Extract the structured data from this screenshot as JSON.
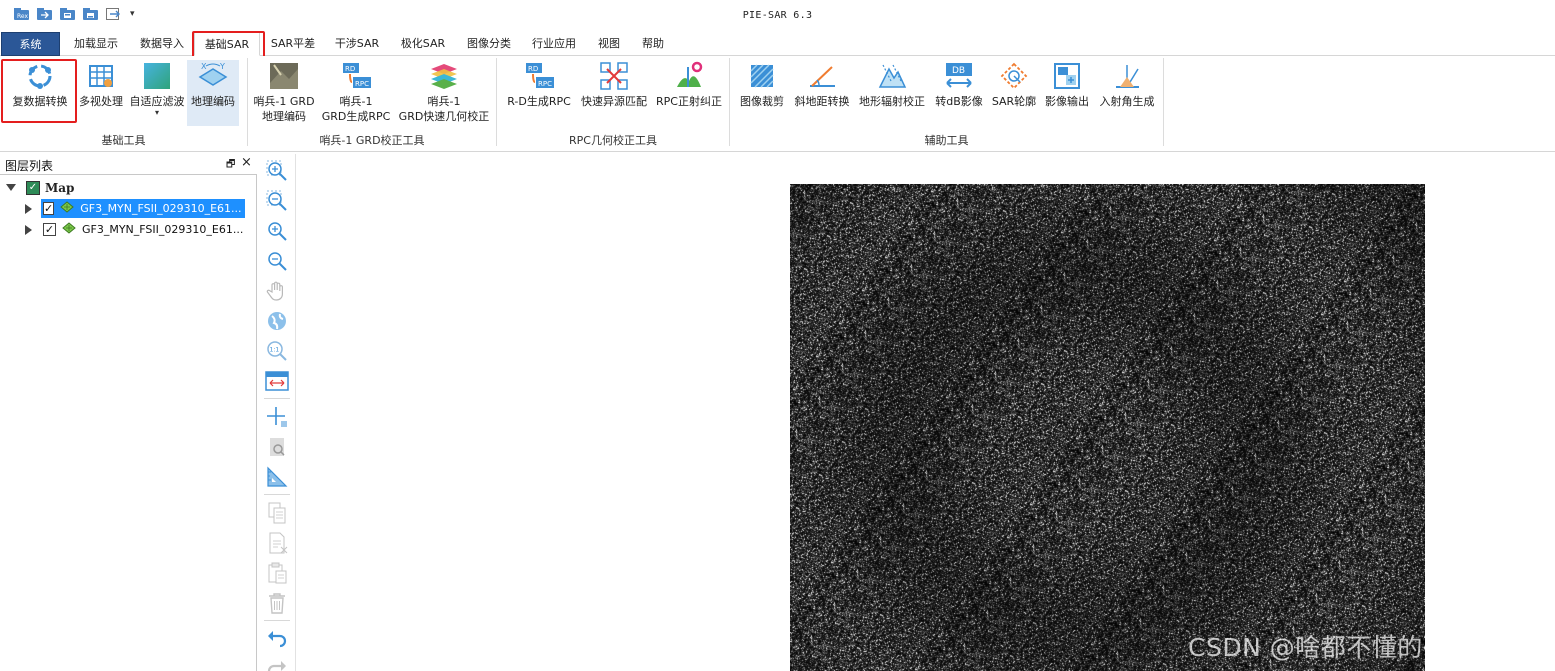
{
  "window": {
    "title": "PIE-SAR 6.3",
    "quick_access": [
      {
        "icon": "new-file-icon"
      },
      {
        "icon": "open-folder-icon"
      },
      {
        "icon": "save-icon"
      },
      {
        "icon": "save-as-icon"
      },
      {
        "icon": "export-icon"
      }
    ],
    "quick_access_dropdown": "▾"
  },
  "menu": {
    "system": "系统",
    "tabs": [
      "加载显示",
      "数据导入",
      "基础SAR",
      "SAR平差",
      "干涉SAR",
      "极化SAR",
      "图像分类",
      "行业应用",
      "视图",
      "帮助"
    ],
    "active_tab": "基础SAR"
  },
  "ribbon": {
    "groups": [
      {
        "label": "基础工具",
        "buttons": [
          {
            "label": "复数据转换",
            "icon": "complex-data-convert-icon",
            "highlighted": true
          },
          {
            "label": "多视处理",
            "icon": "multilook-icon"
          },
          {
            "label": "自适应滤波",
            "icon": "adaptive-filter-icon",
            "dropdown": "▾"
          },
          {
            "label": "地理编码",
            "icon": "geocode-icon"
          }
        ]
      },
      {
        "label": "哨兵-1 GRD校正工具",
        "buttons": [
          {
            "label": "哨兵-1 GRD",
            "label2": "地理编码",
            "icon": "sentinel-geocode-icon"
          },
          {
            "label": "哨兵-1",
            "label2": "GRD生成RPC",
            "icon": "rd-rpc-icon"
          },
          {
            "label": "哨兵-1",
            "label2": "GRD快速几何校正",
            "icon": "fast-geometry-icon"
          }
        ]
      },
      {
        "label": "RPC几何校正工具",
        "buttons": [
          {
            "label": "R-D生成RPC",
            "icon": "rd-rpc-icon"
          },
          {
            "label": "快速异源匹配",
            "icon": "heterologous-match-icon"
          },
          {
            "label": "RPC正射纠正",
            "icon": "ortho-correct-icon"
          }
        ]
      },
      {
        "label": "辅助工具",
        "buttons": [
          {
            "label": "图像裁剪",
            "icon": "image-crop-icon"
          },
          {
            "label": "斜地距转换",
            "icon": "slant-ground-icon"
          },
          {
            "label": "地形辐射校正",
            "icon": "terrain-radiometric-icon"
          },
          {
            "label": "转dB影像",
            "icon": "db-image-icon",
            "badge": "DB"
          },
          {
            "label": "SAR轮廓",
            "icon": "sar-outline-icon"
          },
          {
            "label": "影像输出",
            "icon": "image-export-icon"
          },
          {
            "label": "入射角生成",
            "icon": "incidence-angle-icon"
          }
        ]
      }
    ]
  },
  "layer_panel": {
    "title": "图层列表",
    "pin_glyph": "🗗",
    "close_glyph": "×",
    "root": {
      "label": "Map",
      "checked": true
    },
    "layers": [
      {
        "label": "GF3_MYN_FSII_029310_E61...",
        "checked": true,
        "selected": true
      },
      {
        "label": "GF3_MYN_FSII_029310_E61...",
        "checked": true,
        "selected": false
      }
    ],
    "check_glyph": "✓"
  },
  "map_tools": [
    {
      "icon": "zoom-box-in-icon"
    },
    {
      "icon": "zoom-box-out-icon"
    },
    {
      "icon": "zoom-in-icon"
    },
    {
      "icon": "zoom-out-icon"
    },
    {
      "icon": "pan-hand-icon"
    },
    {
      "icon": "full-extent-globe-icon"
    },
    {
      "icon": "actual-size-icon",
      "text": "1:1"
    },
    {
      "icon": "fit-width-icon"
    },
    {
      "icon": "crosshair-identify-icon"
    },
    {
      "icon": "identify-icon"
    },
    {
      "icon": "measure-icon"
    },
    {
      "icon": "copy-icon"
    },
    {
      "icon": "cut-icon"
    },
    {
      "icon": "paste-icon"
    },
    {
      "icon": "delete-icon"
    },
    {
      "icon": "undo-icon"
    },
    {
      "icon": "redo-icon"
    }
  ],
  "watermark": "CSDN @啥都不懂的研究生",
  "colors": {
    "system_tab": "#2b5797",
    "selection": "#1e90ff",
    "highlight_box": "#e41e1e",
    "icon_blue": "#3b8fd6"
  }
}
